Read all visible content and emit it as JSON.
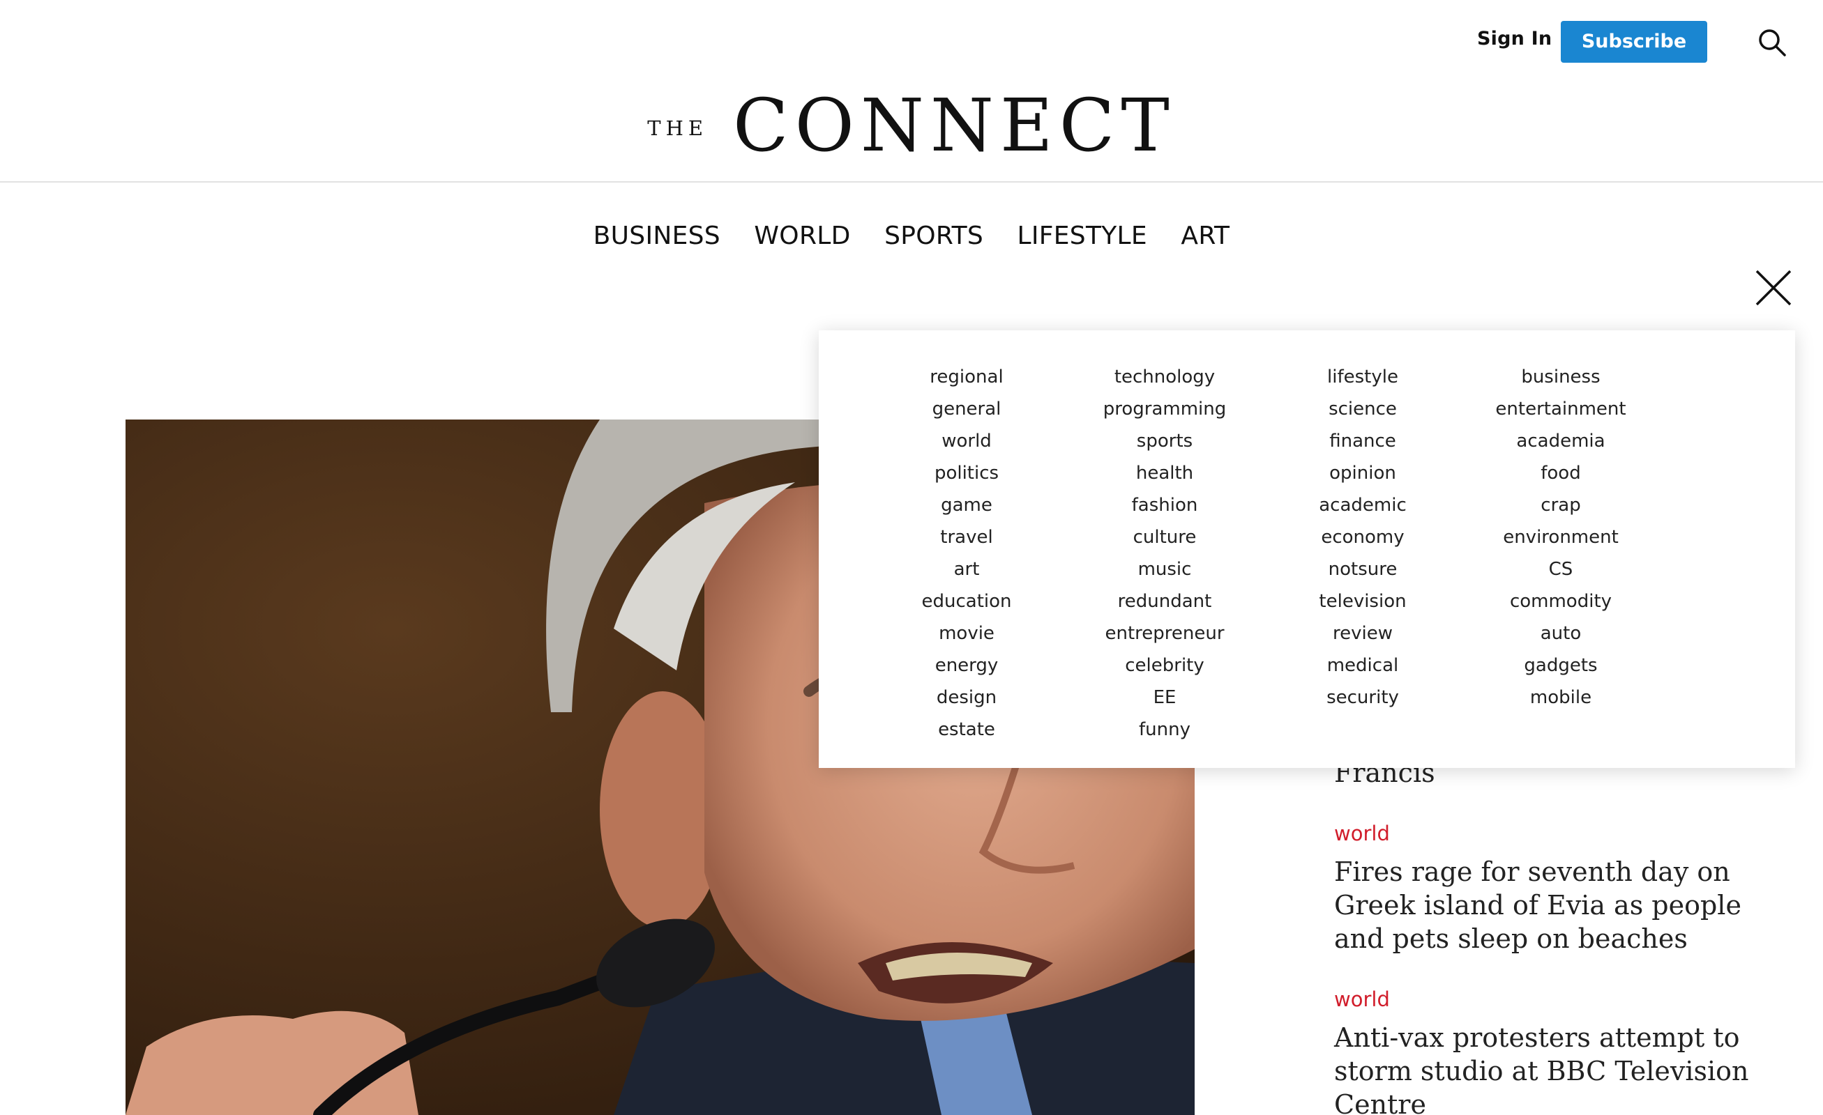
{
  "header": {
    "sign_in": "Sign In",
    "subscribe": "Subscribe",
    "search_icon": "search-icon"
  },
  "logo": {
    "the": "THE",
    "name": "CONNECT"
  },
  "nav": {
    "items": [
      "BUSINESS",
      "WORLD",
      "SPORTS",
      "LIFESTYLE",
      "ART"
    ],
    "close_icon": "close-icon"
  },
  "dropdown": {
    "columns": [
      [
        "regional",
        "general",
        "world",
        "politics",
        "game",
        "travel",
        "art",
        "education",
        "movie",
        "energy",
        "design",
        "estate"
      ],
      [
        "technology",
        "programming",
        "sports",
        "health",
        "fashion",
        "culture",
        "music",
        "redundant",
        "entrepreneur",
        "celebrity",
        "EE",
        "funny"
      ],
      [
        "lifestyle",
        "science",
        "finance",
        "opinion",
        "academic",
        "economy",
        "notsure",
        "television",
        "review",
        "medical",
        "security"
      ],
      [
        "business",
        "entertainment",
        "academia",
        "food",
        "crap",
        "environment",
        "CS",
        "commodity",
        "auto",
        "gadgets",
        "mobile"
      ]
    ]
  },
  "stories": {
    "partial_title": "Francis",
    "items": [
      {
        "category": "world",
        "title": "Fires rage for seventh day on Greek island of Evia as people and pets sleep on beaches"
      },
      {
        "category": "world",
        "title": "Anti-vax protesters attempt to storm studio at BBC Television Centre"
      }
    ]
  },
  "colors": {
    "subscribe_bg": "#1a86d1",
    "category_red": "#d11d2b"
  }
}
